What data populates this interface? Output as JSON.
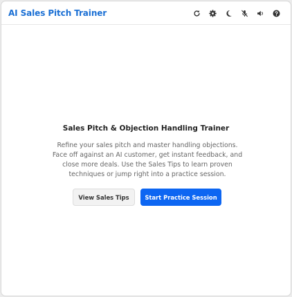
{
  "header": {
    "title": "AI Sales Pitch Trainer",
    "tools": [
      {
        "name": "refresh-icon"
      },
      {
        "name": "gear-icon"
      },
      {
        "name": "moon-icon"
      },
      {
        "name": "mic-off-icon"
      },
      {
        "name": "speaker-icon"
      },
      {
        "name": "help-icon"
      }
    ]
  },
  "main": {
    "heading": "Sales Pitch & Objection Handling Trainer",
    "description": "Refine your sales pitch and master handling objections. Face off against an AI customer, get instant feedback, and close more deals. Use the Sales Tips to learn proven techniques or jump right into a practice session.",
    "secondary_button": "View Sales Tips",
    "primary_button": "Start Practice Session"
  },
  "colors": {
    "accent": "#1a6fd4",
    "primary_button": "#0d66f2"
  }
}
